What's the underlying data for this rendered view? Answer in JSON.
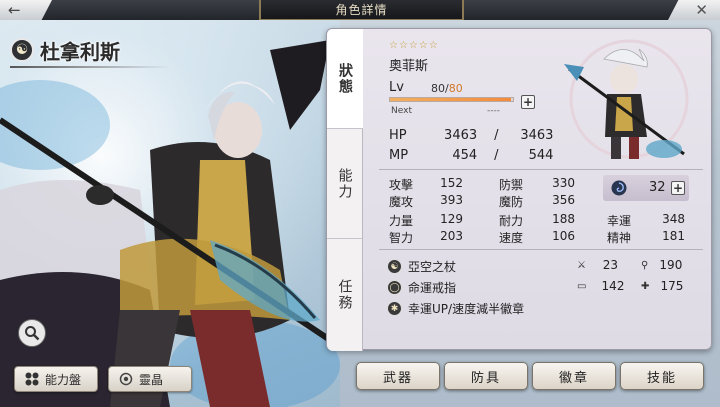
{
  "header": {
    "title": "角色詳情",
    "back_icon": "arrow-left-icon",
    "close_icon": "close-x-icon"
  },
  "character": {
    "name": "杜拿利斯",
    "element_icon": "yin-yang-icon"
  },
  "tabs": [
    {
      "label": "狀態",
      "active": true
    },
    {
      "label": "能力",
      "active": false
    },
    {
      "label": "任務",
      "active": false
    }
  ],
  "status": {
    "stars": "☆☆☆☆☆",
    "star_count": 5,
    "job": "奧菲斯",
    "lv_label": "Lv",
    "lv_current": "80/",
    "lv_max": "80",
    "exp_fraction": 0.98,
    "next_label": "Next",
    "next_value": "----",
    "hp_label": "HP",
    "hp_current": "3463",
    "hp_sep": "/",
    "hp_max": "3463",
    "mp_label": "MP",
    "mp_current": "454",
    "mp_sep": "/",
    "mp_max": "544"
  },
  "stats": {
    "atk_label": "攻擊",
    "atk": "152",
    "def_label": "防禦",
    "def": "330",
    "matk_label": "魔攻",
    "matk": "393",
    "mdef_label": "魔防",
    "mdef": "356",
    "str_label": "力量",
    "str": "129",
    "end_label": "耐力",
    "end": "188",
    "luck_label": "幸運",
    "luck": "348",
    "int_label": "智力",
    "int": "203",
    "spd_label": "速度",
    "spd": "106",
    "spi_label": "精神",
    "spi": "181",
    "points": "32",
    "points_icon": "swirl-icon"
  },
  "equipment": [
    {
      "name": "亞空之杖",
      "icon": "staff-icon"
    },
    {
      "name": "命運戒指",
      "icon": "ring-icon"
    },
    {
      "name": "幸運UP/速度減半徽章",
      "icon": "emblem-icon"
    }
  ],
  "equip_stats": {
    "atk": "23",
    "matk": "190",
    "def": "142",
    "mdef": "175"
  },
  "bottom_left": {
    "ability_board": "能力盤",
    "spirit_crystal": "靈晶"
  },
  "bottom_right": {
    "weapon": "武器",
    "armor": "防具",
    "emblem": "徽章",
    "skill": "技能"
  },
  "colors": {
    "exp_bar": "#f48a3c",
    "lv_max": "#d07a2a",
    "stars": "#c89c3a"
  }
}
